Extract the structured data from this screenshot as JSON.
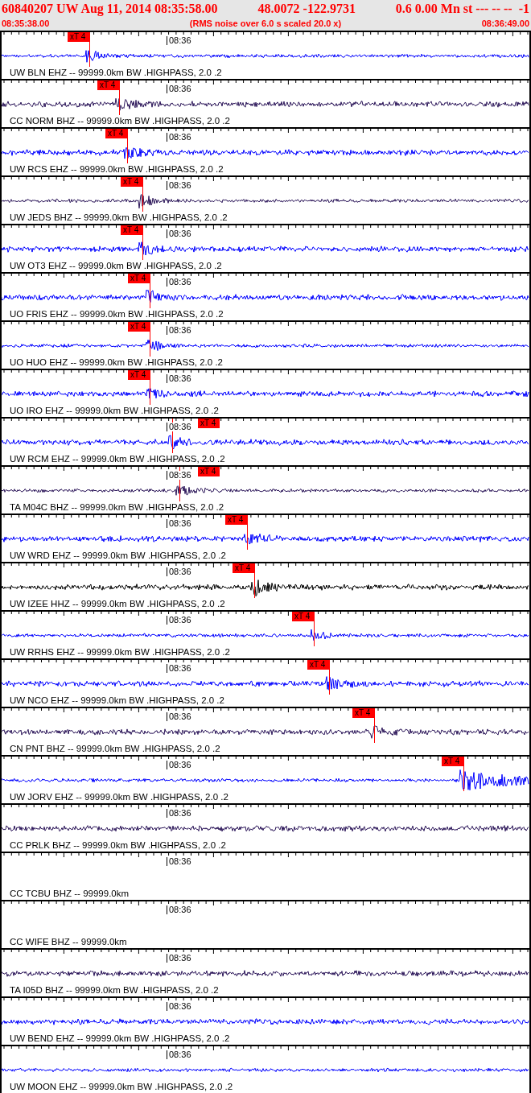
{
  "header": {
    "event": "60840207 UW Aug 11, 2014 08:35:58.00",
    "location": "48.0072 -122.9731",
    "magnitude": "0.6 0.00 Mn st --- -- --  -1",
    "start_time": "08:35:38.00",
    "note": "(RMS noise over 6.0 s scaled 20.0 x)",
    "end_time": "08:36:49.00"
  },
  "traces": [
    {
      "label": "UW BLN EHZ -- 99999.0km BW .HIGHPASS, 2.0 .2",
      "time_label": "08:36",
      "color": "#0000ff",
      "pick": "xT 4"
    },
    {
      "label": "CC NORM BHZ -- 99999.0km BW .HIGHPASS, 2.0 .2",
      "time_label": "08:36",
      "color": "#2a1458",
      "pick": "xT 4"
    },
    {
      "label": "UW RCS EHZ -- 99999.0km BW .HIGHPASS, 2.0 .2",
      "time_label": "08:36",
      "color": "#0000ff",
      "pick": "xT 4"
    },
    {
      "label": "UW JEDS BHZ -- 99999.0km BW .HIGHPASS, 2.0 .2",
      "time_label": "08:36",
      "color": "#2a1458",
      "pick": "xT 4"
    },
    {
      "label": "UW OT3 EHZ -- 99999.0km BW .HIGHPASS, 2.0 .2",
      "time_label": "08:36",
      "color": "#0000ff",
      "pick": "xT 4"
    },
    {
      "label": "UO FRIS EHZ -- 99999.0km BW .HIGHPASS, 2.0 .2",
      "time_label": "08:36",
      "color": "#0000ff",
      "pick": "xT 4"
    },
    {
      "label": "UO HUO EHZ -- 99999.0km BW .HIGHPASS, 2.0 .2",
      "time_label": "08:36",
      "color": "#0000ff",
      "pick": "xT 4"
    },
    {
      "label": "UO IRO EHZ -- 99999.0km BW .HIGHPASS, 2.0 .2",
      "time_label": "08:36",
      "color": "#0000ff",
      "pick": "xT 4"
    },
    {
      "label": "UW RCM EHZ -- 99999.0km BW .HIGHPASS, 2.0 .2",
      "time_label": "08:36",
      "color": "#0000ff",
      "pick": "xT 4"
    },
    {
      "label": "TA M04C BHZ -- 99999.0km BW .HIGHPASS, 2.0 .2",
      "time_label": "08:36",
      "color": "#2a1458",
      "pick": "xT 4"
    },
    {
      "label": "UW WRD EHZ -- 99999.0km BW .HIGHPASS, 2.0 .2",
      "time_label": "08:36",
      "color": "#0000ff",
      "pick": "xT 4"
    },
    {
      "label": "UW IZEE HHZ -- 99999.0km BW .HIGHPASS, 2.0 .2",
      "time_label": "08:36",
      "color": "#000000",
      "pick": "xT 4"
    },
    {
      "label": "UW RRHS EHZ -- 99999.0km BW .HIGHPASS, 2.0 .2",
      "time_label": "08:36",
      "color": "#0000ff",
      "pick": "xT 4"
    },
    {
      "label": "UW NCO EHZ -- 99999.0km BW .HIGHPASS, 2.0 .2",
      "time_label": "08:36",
      "color": "#0000ff",
      "pick": "xT 4"
    },
    {
      "label": "CN PNT BHZ -- 99999.0km BW .HIGHPASS, 2.0 .2",
      "time_label": "08:36",
      "color": "#2a1458",
      "pick": "xT 4"
    },
    {
      "label": "UW JORV EHZ -- 99999.0km BW .HIGHPASS, 2.0 .2",
      "time_label": "08:36",
      "color": "#0000ff",
      "pick": "xT 4"
    },
    {
      "label": "CC PRLK BHZ -- 99999.0km BW .HIGHPASS, 2.0 .2",
      "time_label": "08:36",
      "color": "#2a1458"
    },
    {
      "label": "CC TCBU BHZ -- 99999.0km",
      "time_label": "08:36"
    },
    {
      "label": "CC WIFE BHZ -- 99999.0km",
      "time_label": "08:36"
    },
    {
      "label": "TA I05D BHZ -- 99999.0km BW .HIGHPASS, 2.0 .2",
      "time_label": "08:36",
      "color": "#2a1458"
    },
    {
      "label": "UW BEND EHZ -- 99999.0km BW .HIGHPASS, 2.0 .2",
      "time_label": "08:36",
      "color": "#0000ff"
    },
    {
      "label": "UW MOON EHZ -- 99999.0km BW .HIGHPASS, 2.0 .2",
      "time_label": "08:36",
      "color": "#0000ff"
    }
  ]
}
